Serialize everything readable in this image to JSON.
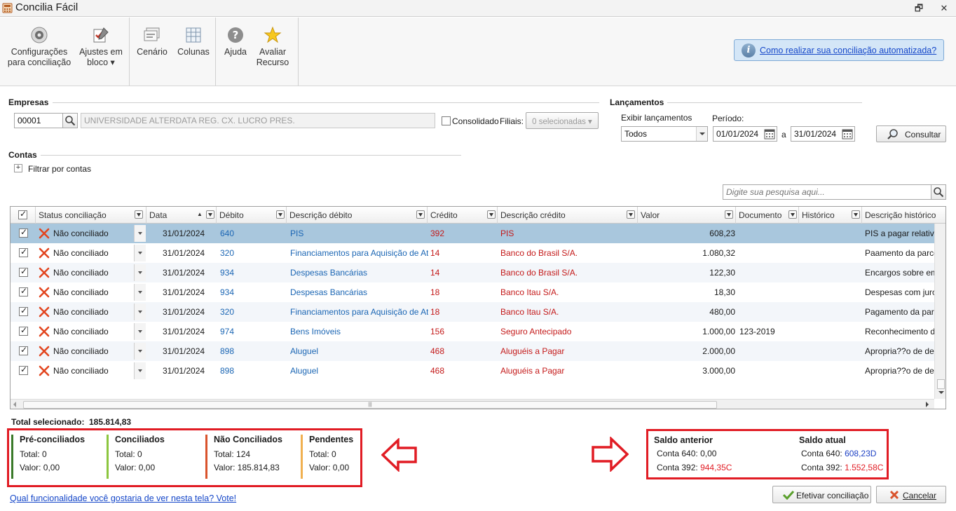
{
  "window": {
    "title": "Concilia Fácil",
    "restore_glyph": "🗗",
    "close_glyph": "✕"
  },
  "ribbon": {
    "config_line1": "Configurações",
    "config_line2": "para conciliação",
    "ajustes_line1": "Ajustes em",
    "ajustes_line2": "bloco ▾",
    "cenario": "Cenário",
    "colunas": "Colunas",
    "ajuda": "Ajuda",
    "avaliar_line1": "Avaliar",
    "avaliar_line2": "Recurso",
    "help_icon_text": "i",
    "help_link": "Como realizar sua conciliação automatizada?"
  },
  "empresas": {
    "title": "Empresas",
    "codigo": "00001",
    "nome": "UNIVERSIDADE ALTERDATA REG. CX. LUCRO PRES.",
    "consolidado_label": "Consolidado",
    "filiais_label": "Filiais:",
    "filiais_value": "0 selecionadas ▾"
  },
  "lancamentos": {
    "title": "Lançamentos",
    "exibir_label": "Exibir lançamentos",
    "exibir_value": "Todos",
    "periodo_label": "Período:",
    "data_inicio": "01/01/2024",
    "separador": "a",
    "data_fim": "31/01/2024",
    "consultar_label": "Consultar"
  },
  "contas": {
    "title": "Contas",
    "filtrar_label": "Filtrar por contas",
    "expand_glyph": "+"
  },
  "search": {
    "placeholder": "Digite sua pesquisa aqui..."
  },
  "grid": {
    "columns": {
      "status": "Status conciliação",
      "data": "Data",
      "debito": "Débito",
      "desc_debito": "Descrição débito",
      "credito": "Crédito",
      "desc_credito": "Descrição crédito",
      "valor": "Valor",
      "documento": "Documento",
      "historico": "Histórico",
      "desc_historico": "Descrição histórico"
    },
    "sort_glyph": "▲",
    "hscroll_grip": "|||",
    "rows": [
      {
        "status": "Não conciliado",
        "data": "31/01/2024",
        "debito": "640",
        "desc_debito": "PIS",
        "credito": "392",
        "desc_credito": "PIS",
        "valor": "608,23",
        "documento": "",
        "historico": "",
        "desc_historico": "PIS a pagar relativo"
      },
      {
        "status": "Não conciliado",
        "data": "31/01/2024",
        "debito": "320",
        "desc_debito": "Financiamentos para Aquisição de Ativos",
        "credito": "14",
        "desc_credito": "Banco do Brasil S/A.",
        "valor": "1.080,32",
        "documento": "",
        "historico": "",
        "desc_historico": "Paamento da parcela"
      },
      {
        "status": "Não conciliado",
        "data": "31/01/2024",
        "debito": "934",
        "desc_debito": "Despesas Bancárias",
        "credito": "14",
        "desc_credito": "Banco do Brasil S/A.",
        "valor": "122,30",
        "documento": "",
        "historico": "",
        "desc_historico": "Encargos sobre empr"
      },
      {
        "status": "Não conciliado",
        "data": "31/01/2024",
        "debito": "934",
        "desc_debito": "Despesas Bancárias",
        "credito": "18",
        "desc_credito": "Banco Itau S/A.",
        "valor": "18,30",
        "documento": "",
        "historico": "",
        "desc_historico": "Despesas com juros"
      },
      {
        "status": "Não conciliado",
        "data": "31/01/2024",
        "debito": "320",
        "desc_debito": "Financiamentos para Aquisição de Ativos",
        "credito": "18",
        "desc_credito": "Banco Itau S/A.",
        "valor": "480,00",
        "documento": "",
        "historico": "",
        "desc_historico": "Pagamento da parce"
      },
      {
        "status": "Não conciliado",
        "data": "31/01/2024",
        "debito": "974",
        "desc_debito": "Bens Imóveis",
        "credito": "156",
        "desc_credito": "Seguro Antecipado",
        "valor": "1.000,00",
        "documento": "123-2019",
        "historico": "",
        "desc_historico": "Reconhecimento da"
      },
      {
        "status": "Não conciliado",
        "data": "31/01/2024",
        "debito": "898",
        "desc_debito": "Aluguel",
        "credito": "468",
        "desc_credito": "Aluguéis a Pagar",
        "valor": "2.000,00",
        "documento": "",
        "historico": "",
        "desc_historico": "Apropria??o de desp"
      },
      {
        "status": "Não conciliado",
        "data": "31/01/2024",
        "debito": "898",
        "desc_debito": "Aluguel",
        "credito": "468",
        "desc_credito": "Aluguéis a Pagar",
        "valor": "3.000,00",
        "documento": "",
        "historico": "",
        "desc_historico": "Apropria??o de desp"
      }
    ]
  },
  "total_selecionado": {
    "label": "Total selecionado:",
    "value": "185.814,83"
  },
  "resumo": {
    "pre": {
      "title": "Pré-conciliados",
      "total": "Total: 0",
      "valor": "Valor: 0,00",
      "color": "#3a7a2a"
    },
    "conc": {
      "title": "Conciliados",
      "total": "Total: 0",
      "valor": "Valor: 0,00",
      "color": "#8cc63f"
    },
    "nao": {
      "title": "Não Conciliados",
      "total": "Total: 124",
      "valor": "Valor: 185.814,83",
      "color": "#d9532c"
    },
    "pend": {
      "title": "Pendentes",
      "total": "Total: 0",
      "valor": "Valor: 0,00",
      "color": "#f0b050"
    }
  },
  "saldos": {
    "anterior_title": "Saldo anterior",
    "anterior_640_label": "Conta 640:",
    "anterior_640_value": "0,00",
    "anterior_392_label": "Conta 392:",
    "anterior_392_value": "944,35C",
    "atual_title": "Saldo atual",
    "atual_640_label": "Conta 640:",
    "atual_640_value": "608,23D",
    "atual_392_label": "Conta 392:",
    "atual_392_value": "1.552,58C"
  },
  "footer": {
    "vote_link": "Qual funcionalidade você gostaria de ver nesta tela? Vote!",
    "efetivar_label": "Efetivar conciliação",
    "cancelar_label": "Cancelar"
  },
  "colors": {
    "highlight_red": "#e11c24",
    "link_blue": "#1547c9",
    "row_selected": "#a9c7dd"
  }
}
